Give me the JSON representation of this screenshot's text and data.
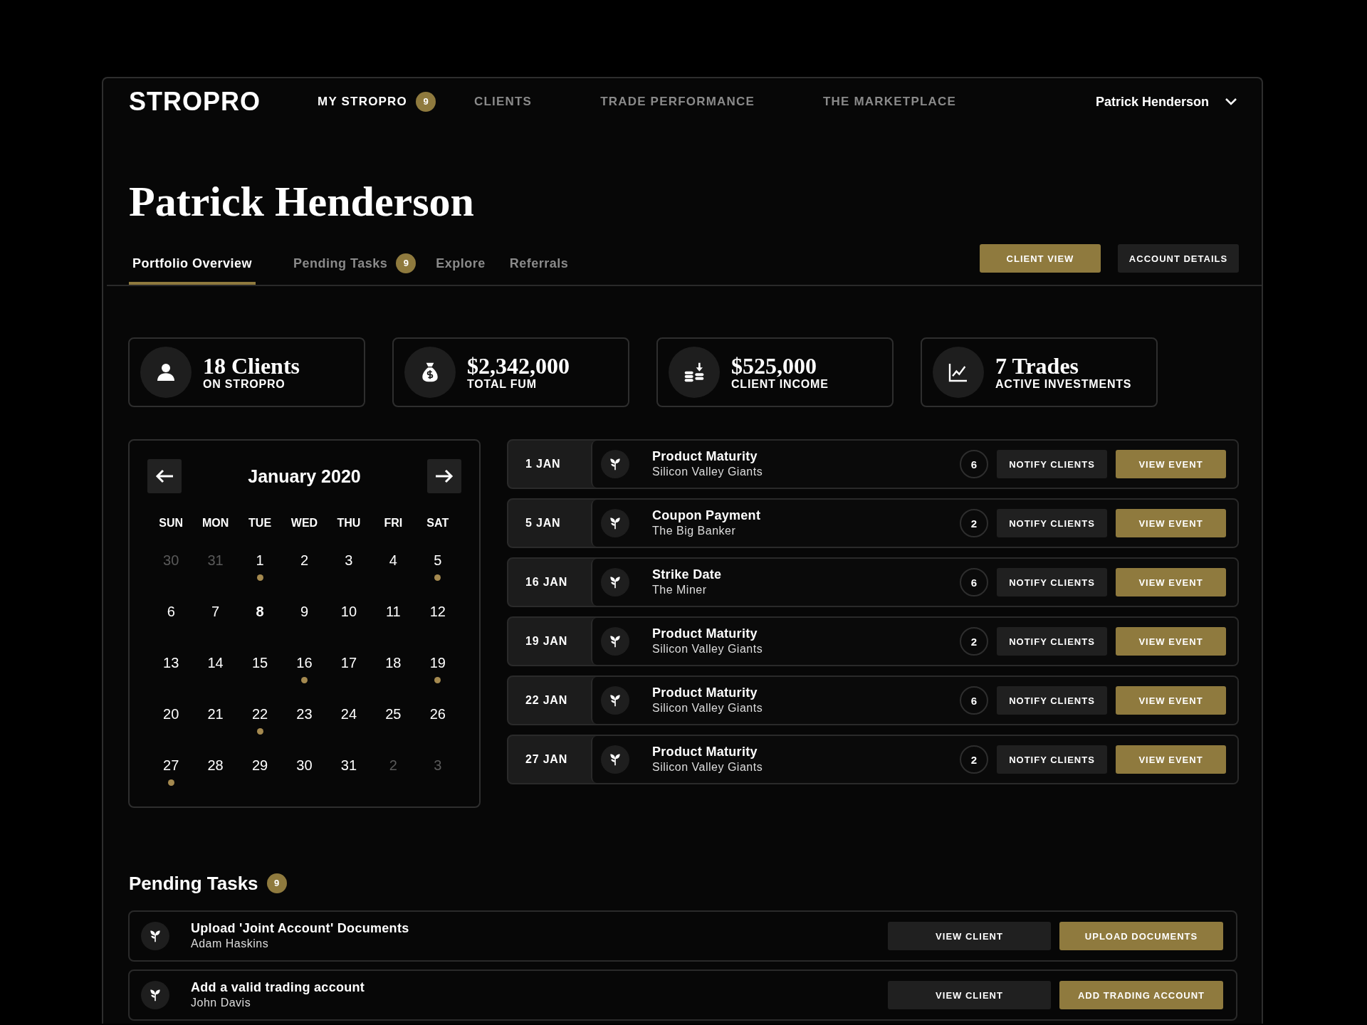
{
  "header": {
    "logo": "STROPRO",
    "nav": [
      {
        "label": "MY STROPRO",
        "selected": true,
        "badge": "9"
      },
      {
        "label": "CLIENTS",
        "selected": false
      },
      {
        "label": "TRADE PERFORMANCE",
        "selected": false
      },
      {
        "label": "THE MARKETPLACE",
        "selected": false
      }
    ],
    "user": "Patrick Henderson"
  },
  "page_title": "Patrick Henderson",
  "tabs": [
    {
      "label": "Portfolio Overview",
      "selected": true
    },
    {
      "label": "Pending Tasks",
      "selected": false,
      "badge": "9"
    },
    {
      "label": "Explore",
      "selected": false
    },
    {
      "label": "Referrals",
      "selected": false
    }
  ],
  "actions": [
    {
      "label": "CLIENT VIEW",
      "kind": "primary"
    },
    {
      "label": "ACCOUNT DETAILS",
      "kind": "secondary"
    }
  ],
  "stats": [
    {
      "kind": "person",
      "value": "18 Clients",
      "label": "ON STROPRO"
    },
    {
      "kind": "moneybag",
      "value": "$2,342,000",
      "label": "TOTAL FUM"
    },
    {
      "kind": "coins",
      "value": "$525,000",
      "label": "CLIENT INCOME"
    },
    {
      "kind": "chart",
      "value": "7 Trades",
      "label": "ACTIVE INVESTMENTS"
    }
  ],
  "calendar": {
    "month": "January 2020",
    "weekdays": [
      "SUN",
      "MON",
      "TUE",
      "WED",
      "THU",
      "FRI",
      "SAT"
    ],
    "days": [
      {
        "label": "30",
        "muted": true,
        "today": false,
        "event": false
      },
      {
        "label": "31",
        "muted": true,
        "today": false,
        "event": false
      },
      {
        "label": "1",
        "muted": false,
        "today": false,
        "event": true
      },
      {
        "label": "2",
        "muted": false,
        "today": false,
        "event": false
      },
      {
        "label": "3",
        "muted": false,
        "today": false,
        "event": false
      },
      {
        "label": "4",
        "muted": false,
        "today": false,
        "event": false
      },
      {
        "label": "5",
        "muted": false,
        "today": false,
        "event": true
      },
      {
        "label": "6",
        "muted": false,
        "today": false,
        "event": false
      },
      {
        "label": "7",
        "muted": false,
        "today": false,
        "event": false
      },
      {
        "label": "8",
        "muted": false,
        "today": true,
        "event": false
      },
      {
        "label": "9",
        "muted": false,
        "today": false,
        "event": false
      },
      {
        "label": "10",
        "muted": false,
        "today": false,
        "event": false
      },
      {
        "label": "11",
        "muted": false,
        "today": false,
        "event": false
      },
      {
        "label": "12",
        "muted": false,
        "today": false,
        "event": false
      },
      {
        "label": "13",
        "muted": false,
        "today": false,
        "event": false
      },
      {
        "label": "14",
        "muted": false,
        "today": false,
        "event": false
      },
      {
        "label": "15",
        "muted": false,
        "today": false,
        "event": false
      },
      {
        "label": "16",
        "muted": false,
        "today": false,
        "event": true
      },
      {
        "label": "17",
        "muted": false,
        "today": false,
        "event": false
      },
      {
        "label": "18",
        "muted": false,
        "today": false,
        "event": false
      },
      {
        "label": "19",
        "muted": false,
        "today": false,
        "event": true
      },
      {
        "label": "20",
        "muted": false,
        "today": false,
        "event": false
      },
      {
        "label": "21",
        "muted": false,
        "today": false,
        "event": false
      },
      {
        "label": "22",
        "muted": false,
        "today": false,
        "event": true
      },
      {
        "label": "23",
        "muted": false,
        "today": false,
        "event": false
      },
      {
        "label": "24",
        "muted": false,
        "today": false,
        "event": false
      },
      {
        "label": "25",
        "muted": false,
        "today": false,
        "event": false
      },
      {
        "label": "26",
        "muted": false,
        "today": false,
        "event": false
      },
      {
        "label": "27",
        "muted": false,
        "today": false,
        "event": true
      },
      {
        "label": "28",
        "muted": false,
        "today": false,
        "event": false
      },
      {
        "label": "29",
        "muted": false,
        "today": false,
        "event": false
      },
      {
        "label": "30",
        "muted": false,
        "today": false,
        "event": false
      },
      {
        "label": "31",
        "muted": false,
        "today": false,
        "event": false
      },
      {
        "label": "2",
        "muted": true,
        "today": false,
        "event": false
      },
      {
        "label": "3",
        "muted": true,
        "today": false,
        "event": false
      }
    ]
  },
  "events": [
    {
      "date": "1 JAN",
      "title": "Product Maturity",
      "subtitle": "Silicon Valley Giants",
      "count": "6",
      "notify": "NOTIFY CLIENTS",
      "view": "VIEW EVENT"
    },
    {
      "date": "5 JAN",
      "title": "Coupon Payment",
      "subtitle": "The Big Banker",
      "count": "2",
      "notify": "NOTIFY CLIENTS",
      "view": "VIEW EVENT"
    },
    {
      "date": "16 JAN",
      "title": "Strike Date",
      "subtitle": "The Miner",
      "count": "6",
      "notify": "NOTIFY CLIENTS",
      "view": "VIEW EVENT"
    },
    {
      "date": "19 JAN",
      "title": "Product Maturity",
      "subtitle": "Silicon Valley Giants",
      "count": "2",
      "notify": "NOTIFY CLIENTS",
      "view": "VIEW EVENT"
    },
    {
      "date": "22 JAN",
      "title": "Product Maturity",
      "subtitle": "Silicon Valley Giants",
      "count": "6",
      "notify": "NOTIFY CLIENTS",
      "view": "VIEW EVENT"
    },
    {
      "date": "27 JAN",
      "title": "Product Maturity",
      "subtitle": "Silicon Valley Giants",
      "count": "2",
      "notify": "NOTIFY CLIENTS",
      "view": "VIEW EVENT"
    }
  ],
  "pending_tasks": {
    "title": "Pending Tasks",
    "badge": "9",
    "items": [
      {
        "title": "Upload 'Joint Account' Documents",
        "subtitle": "Adam Haskins",
        "secondary": "VIEW CLIENT",
        "primary": "UPLOAD DOCUMENTS"
      },
      {
        "title": "Add a valid trading account",
        "subtitle": "John Davis",
        "secondary": "VIEW CLIENT",
        "primary": "ADD TRADING ACCOUNT"
      }
    ]
  }
}
